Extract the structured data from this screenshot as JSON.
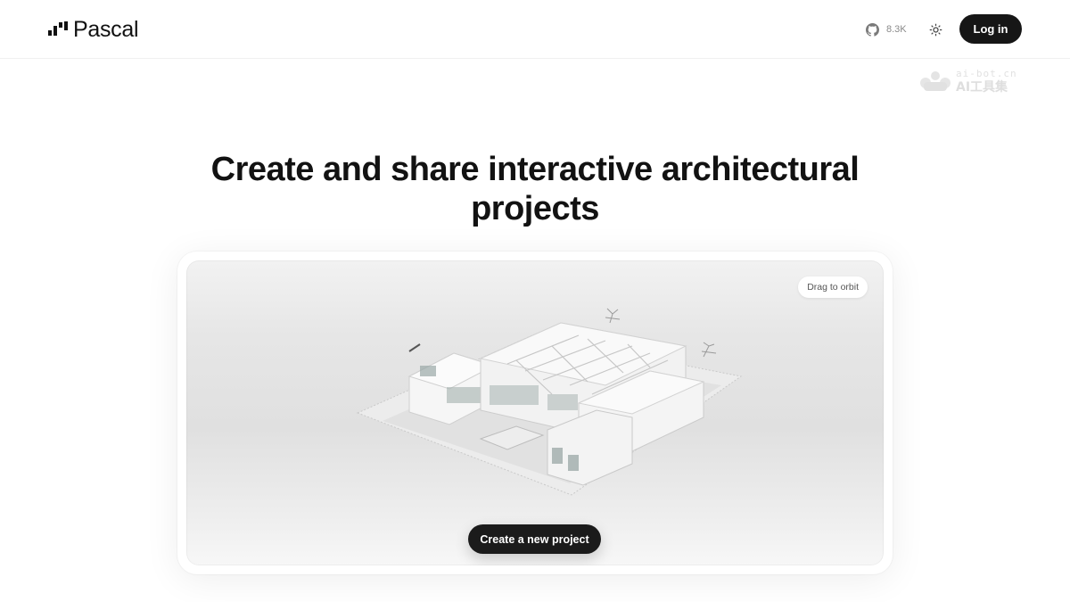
{
  "brand": {
    "name": "Pascal"
  },
  "header": {
    "github": {
      "icon": "github-icon",
      "stars": "8.3K"
    },
    "theme_toggle": {
      "icon": "sun-icon"
    },
    "login_label": "Log in"
  },
  "watermark": {
    "top": "ai-bot.cn",
    "bottom": "AI工具集"
  },
  "hero": {
    "title": "Create and share interactive architectural projects"
  },
  "showcase": {
    "hint": "Drag to orbit",
    "cta_label": "Create a new project"
  },
  "colors": {
    "primary": "#161616",
    "background": "#ffffff",
    "viewport": "#e4e4e4"
  }
}
